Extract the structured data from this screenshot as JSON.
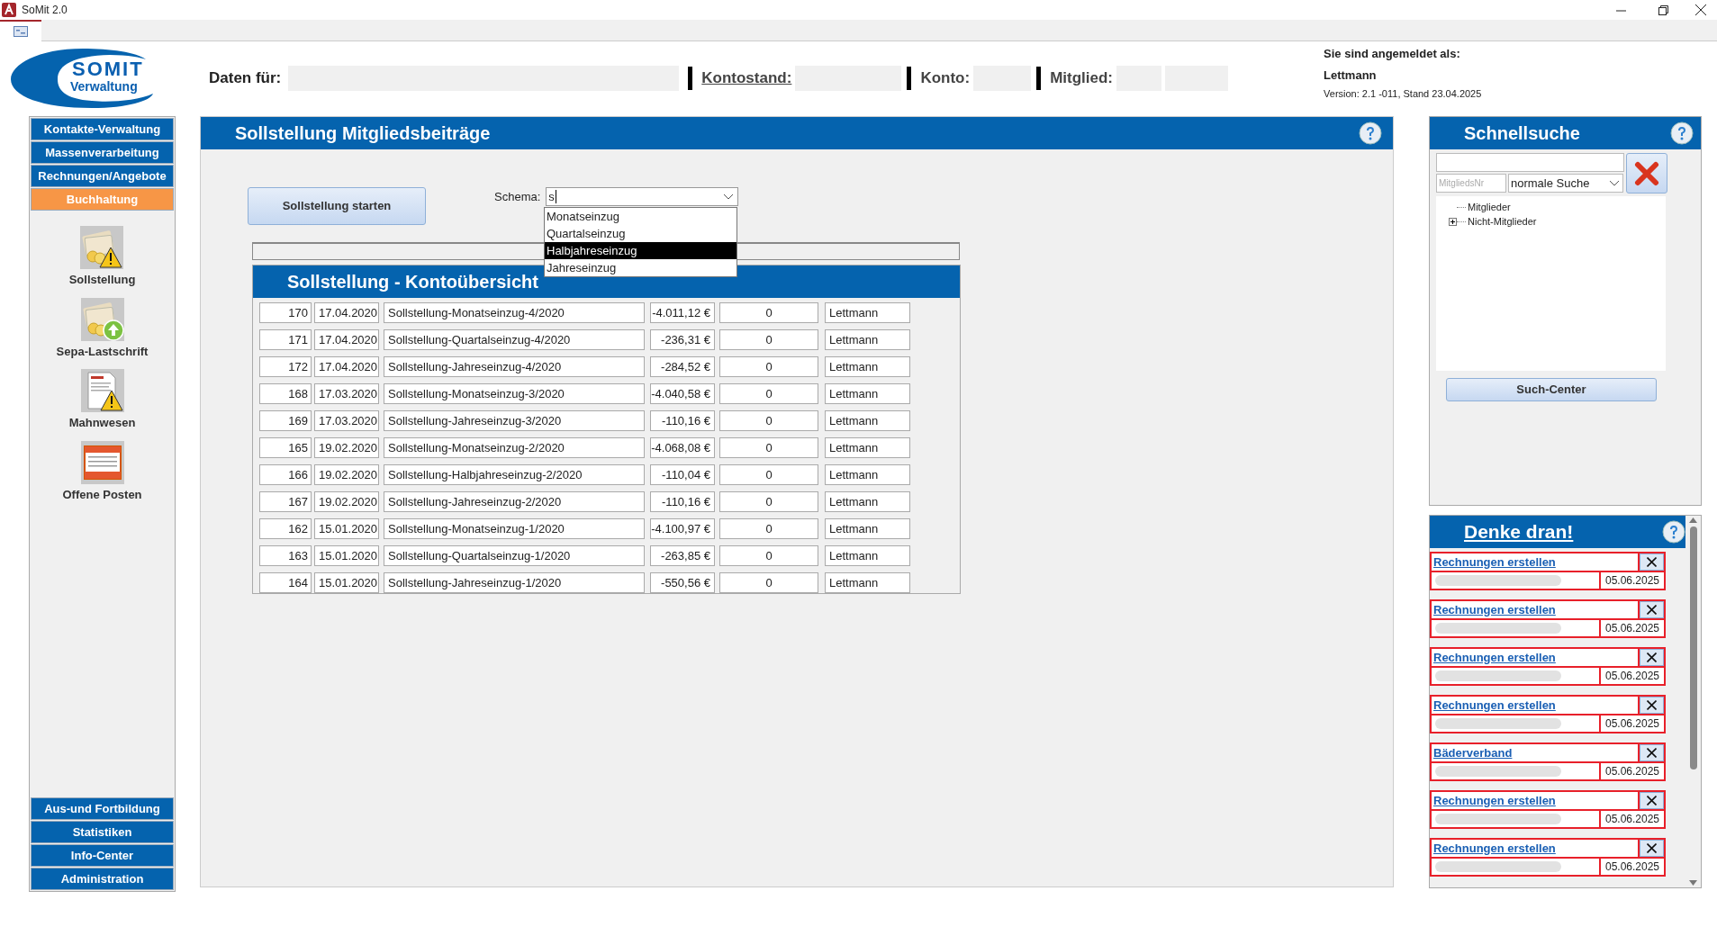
{
  "window": {
    "title": "SoMit 2.0"
  },
  "logo": {
    "line1": "SOMIT",
    "line2": "Verwaltung"
  },
  "header": {
    "daten_label": "Daten für:",
    "kontostand_label": "Kontostand:",
    "konto_label": "Konto:",
    "mitglied_label": "Mitglied:",
    "login_label": "Sie sind angemeldet als:",
    "user": "Lettmann",
    "version": "Version: 2.1 -011, Stand 23.04.2025"
  },
  "sidebar": {
    "top_items": [
      {
        "label": "Kontakte-Verwaltung",
        "selected": false
      },
      {
        "label": "Massenverarbeitung",
        "selected": false
      },
      {
        "label": "Rechnungen/Angebote",
        "selected": false
      },
      {
        "label": "Buchhaltung",
        "selected": true
      }
    ],
    "tools": [
      {
        "label": "Sollstellung",
        "kind": "money-warning"
      },
      {
        "label": "Sepa-Lastschrift",
        "kind": "money-upload"
      },
      {
        "label": "Mahnwesen",
        "kind": "letter-warning"
      },
      {
        "label": "Offene Posten",
        "kind": "statement"
      }
    ],
    "bottom_items": [
      {
        "label": "Aus-und Fortbildung",
        "selected": false
      },
      {
        "label": "Statistiken",
        "selected": false
      },
      {
        "label": "Info-Center",
        "selected": false
      },
      {
        "label": "Administration",
        "selected": false
      }
    ]
  },
  "main": {
    "title": "Sollstellung Mitgliedsbeiträge",
    "start_button": "Sollstellung starten",
    "progress": {
      "level": 0
    },
    "schema": {
      "label": "Schema:",
      "value": "s",
      "options": [
        {
          "label": "Monatseinzug",
          "selected": false
        },
        {
          "label": "Quartalseinzug",
          "selected": false
        },
        {
          "label": "Halbjahreseinzug",
          "selected": true
        },
        {
          "label": "Jahreseinzug",
          "selected": false
        }
      ]
    },
    "table": {
      "title": "Sollstellung - Kontoübersicht",
      "rows": [
        [
          "170",
          "17.04.2020",
          "Sollstellung-Monatseinzug-4/2020",
          "-4.011,12 €",
          "0",
          "Lettmann"
        ],
        [
          "171",
          "17.04.2020",
          "Sollstellung-Quartalseinzug-4/2020",
          "-236,31 €",
          "0",
          "Lettmann"
        ],
        [
          "172",
          "17.04.2020",
          "Sollstellung-Jahreseinzug-4/2020",
          "-284,52 €",
          "0",
          "Lettmann"
        ],
        [
          "168",
          "17.03.2020",
          "Sollstellung-Monatseinzug-3/2020",
          "-4.040,58 €",
          "0",
          "Lettmann"
        ],
        [
          "169",
          "17.03.2020",
          "Sollstellung-Jahreseinzug-3/2020",
          "-110,16 €",
          "0",
          "Lettmann"
        ],
        [
          "165",
          "19.02.2020",
          "Sollstellung-Monatseinzug-2/2020",
          "-4.068,08 €",
          "0",
          "Lettmann"
        ],
        [
          "166",
          "19.02.2020",
          "Sollstellung-Halbjahreseinzug-2/2020",
          "-110,04 €",
          "0",
          "Lettmann"
        ],
        [
          "167",
          "19.02.2020",
          "Sollstellung-Jahreseinzug-2/2020",
          "-110,16 €",
          "0",
          "Lettmann"
        ],
        [
          "162",
          "15.01.2020",
          "Sollstellung-Monatseinzug-1/2020",
          "-4.100,97 €",
          "0",
          "Lettmann"
        ],
        [
          "163",
          "15.01.2020",
          "Sollstellung-Quartalseinzug-1/2020",
          "-263,85 €",
          "0",
          "Lettmann"
        ],
        [
          "164",
          "15.01.2020",
          "Sollstellung-Jahreseinzug-1/2020",
          "-550,56 €",
          "0",
          "Lettmann"
        ]
      ]
    }
  },
  "quick_search": {
    "title": "Schnellsuche",
    "number_placeholder": "MitgliedsNr",
    "mode": "normale Suche",
    "tree": [
      {
        "label": "Mitglieder"
      },
      {
        "label": "Nicht-Mitglieder",
        "expanded": false
      }
    ],
    "search_button": "Such-Center"
  },
  "reminders": {
    "title": "Denke dran!",
    "items": [
      {
        "title": "Rechnungen erstellen",
        "date": "05.06.2025"
      },
      {
        "title": "Rechnungen erstellen",
        "date": "05.06.2025"
      },
      {
        "title": "Rechnungen erstellen",
        "date": "05.06.2025"
      },
      {
        "title": "Rechnungen erstellen",
        "date": "05.06.2025"
      },
      {
        "title": "Bäderverband",
        "date": "05.06.2025"
      },
      {
        "title": "Rechnungen erstellen",
        "date": "05.06.2025"
      },
      {
        "title": "Rechnungen erstellen",
        "date": "05.06.2025"
      }
    ]
  }
}
